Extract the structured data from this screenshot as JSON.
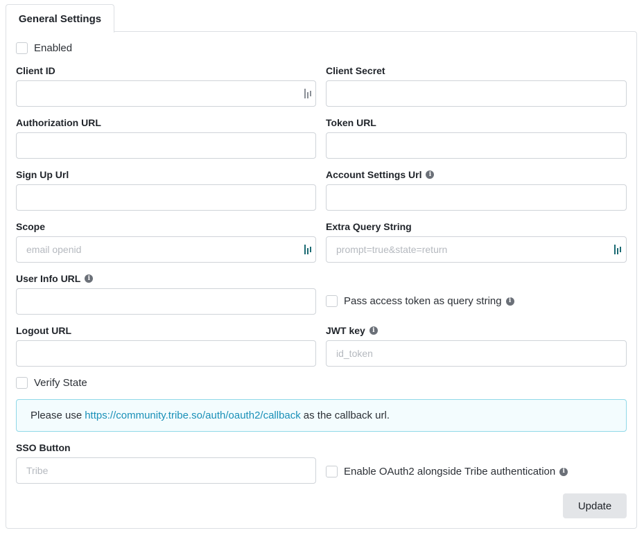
{
  "tab": {
    "label": "General Settings"
  },
  "enabled": {
    "label": "Enabled"
  },
  "fields": {
    "client_id": {
      "label": "Client ID",
      "value": "",
      "placeholder": ""
    },
    "client_secret": {
      "label": "Client Secret",
      "value": "",
      "placeholder": ""
    },
    "authorization_url": {
      "label": "Authorization URL",
      "value": "",
      "placeholder": ""
    },
    "token_url": {
      "label": "Token URL",
      "value": "",
      "placeholder": ""
    },
    "signup_url": {
      "label": "Sign Up Url",
      "value": "",
      "placeholder": ""
    },
    "account_settings_url": {
      "label": "Account Settings Url",
      "value": "",
      "placeholder": ""
    },
    "scope": {
      "label": "Scope",
      "value": "",
      "placeholder": "email openid"
    },
    "extra_query_string": {
      "label": "Extra Query String",
      "value": "",
      "placeholder": "prompt=true&state=return"
    },
    "user_info_url": {
      "label": "User Info URL",
      "value": "",
      "placeholder": ""
    },
    "logout_url": {
      "label": "Logout URL",
      "value": "",
      "placeholder": ""
    },
    "jwt_key": {
      "label": "JWT key",
      "value": "",
      "placeholder": "id_token"
    },
    "sso_button": {
      "label": "SSO Button",
      "value": "",
      "placeholder": "Tribe"
    }
  },
  "checkboxes": {
    "pass_token": {
      "label": "Pass access token as query string"
    },
    "verify_state": {
      "label": "Verify State"
    },
    "enable_oauth2": {
      "label": "Enable OAuth2 alongside Tribe authentication"
    }
  },
  "notice": {
    "prefix": "Please use",
    "link": "https://community.tribe.so/auth/oauth2/callback",
    "suffix": "as the callback url."
  },
  "update_button": {
    "label": "Update"
  },
  "icons": {
    "info": "info-icon",
    "password_manager": "password-manager-icon"
  }
}
